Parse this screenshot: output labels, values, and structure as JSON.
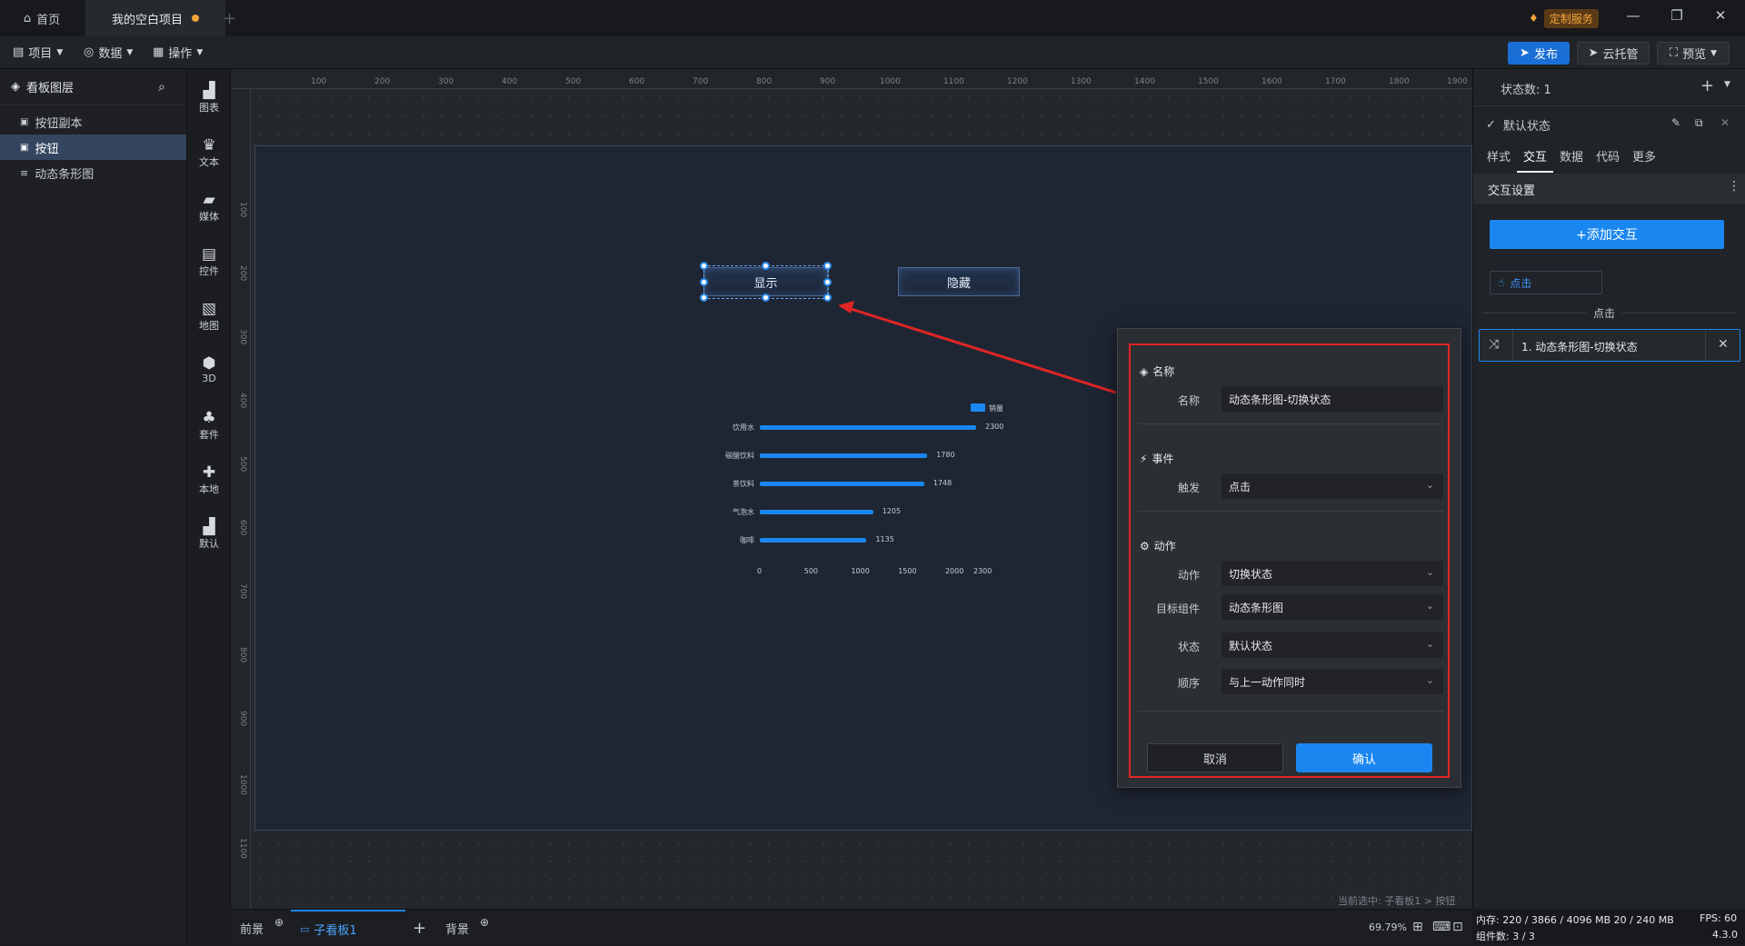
{
  "titlebar": {
    "home_tab": "首页",
    "project_tab": "我的空白项目",
    "service_label": "定制服务"
  },
  "menubar": {
    "menus": [
      "项目",
      "数据",
      "操作"
    ],
    "publish": "发布",
    "cloud": "云托管",
    "preview": "预览"
  },
  "layers": {
    "title": "看板图层",
    "items": [
      "按钮副本",
      "按钮",
      "动态条形图"
    ]
  },
  "components": [
    "图表",
    "文本",
    "媒体",
    "控件",
    "地图",
    "3D",
    "套件",
    "本地",
    "默认"
  ],
  "ruler": {
    "top": [
      "100",
      "200",
      "300",
      "400",
      "500",
      "600",
      "700",
      "800",
      "900",
      "1000",
      "1100",
      "1200",
      "1300",
      "1400",
      "1500",
      "1600",
      "1700",
      "1800",
      "1900"
    ],
    "left": [
      "100",
      "200",
      "300",
      "400",
      "500",
      "600",
      "700",
      "800",
      "900",
      "1000",
      "1100"
    ]
  },
  "canvas": {
    "button_show": "显示",
    "button_hide": "隐藏"
  },
  "chart_data": {
    "type": "bar",
    "orientation": "horizontal",
    "legend": [
      "销量"
    ],
    "categories": [
      "饮用水",
      "碳酸饮料",
      "茶饮料",
      "气泡水",
      "咖啡"
    ],
    "series": [
      {
        "name": "销量",
        "values": [
          2300,
          1780,
          1748,
          1205,
          1135
        ]
      }
    ],
    "x_ticks": [
      "0",
      "500",
      "1000",
      "1500",
      "2000",
      "2300"
    ],
    "xlim": [
      0,
      2300
    ],
    "color": "#1a87f0"
  },
  "dialog": {
    "name_section": "名称",
    "name_label": "名称",
    "name_value": "动态条形图-切换状态",
    "event_section": "事件",
    "trigger_label": "触发",
    "trigger_value": "点击",
    "action_section": "动作",
    "action_label": "动作",
    "action_value": "切换状态",
    "target_label": "目标组件",
    "target_value": "动态条形图",
    "state_label": "状态",
    "state_value": "默认状态",
    "order_label": "顺序",
    "order_value": "与上一动作同时",
    "cancel": "取消",
    "confirm": "确认"
  },
  "bottombar": {
    "foreground": "前景",
    "subboard": "子看板1",
    "background": "背景",
    "selection": "当前选中: 子看板1 > 按钮",
    "zoom": "69.79%"
  },
  "right": {
    "state_count": "状态数: 1",
    "default_state": "默认状态",
    "tabs": [
      "样式",
      "交互",
      "数据",
      "代码",
      "更多"
    ],
    "section_title": "交互设置",
    "add_button": "+添加交互",
    "event_chip": "点击",
    "group_label": "点击",
    "interaction_item": "1. 动态条形图-切换状态"
  },
  "status": {
    "memory": "内存: 220 / 3866 / 4096 MB  20 / 240 MB",
    "fps": "FPS: 60",
    "components": "组件数: 3 / 3",
    "version": "4.3.0"
  },
  "colors": {
    "accent": "#1a87f0",
    "highlight": "#e02525",
    "service": "#f2a43a"
  }
}
